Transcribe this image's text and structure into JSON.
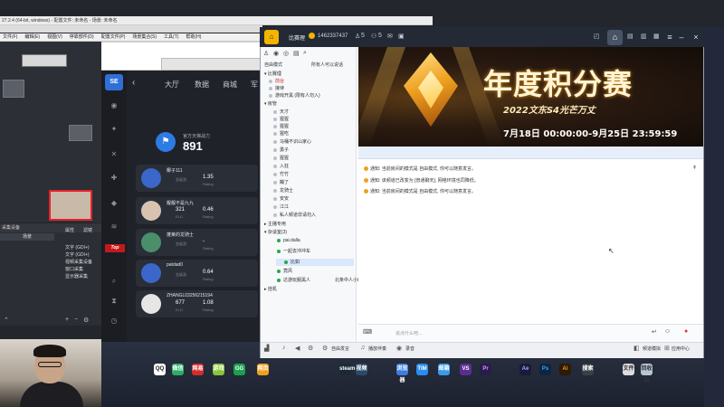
{
  "editor": {
    "title": "27.2.4 (64-bit, windows) - 配置文件: 未命名 - 场景: 未命名"
  },
  "obs": {
    "menu": [
      "文件(F)",
      "编辑(E)",
      "视图(V)",
      "停靠部件(D)",
      "配置文件(P)",
      "场景集合(S)",
      "工具(T)",
      "帮助(H)"
    ],
    "scene_header": "采集设备",
    "scene_sub": "场景",
    "sources": [
      "属性",
      "滤镜"
    ],
    "source_items": [
      "文字 (GDI+)",
      "文字 (GDI+)",
      "视频采集设备",
      "窗口采集",
      "显示器采集"
    ]
  },
  "game": {
    "logo": "SE",
    "tabs": [
      "大厅",
      "数据",
      "商城",
      "军"
    ],
    "top_badge": "Top",
    "fight_label": "官方天梯战力",
    "fight_value": "891",
    "ranks": [
      {
        "name": "椰子111",
        "n1": "1.35",
        "l1": "金级游",
        "n2": "",
        "l2": "Rating"
      },
      {
        "name": "靓靓不是九九",
        "n1": "321",
        "l1": "ELO",
        "n2": "0.46",
        "l2": "Rating"
      },
      {
        "name": "蓬莱的龙骑士",
        "n1": "-",
        "l1": "金级游",
        "n2": "-",
        "l2": "Rating"
      },
      {
        "name": "patdad0",
        "n1": "0.64",
        "l1": "金级游",
        "n2": "",
        "l2": "Rating"
      },
      {
        "name": "ZHANGL03256215194",
        "n1": "677",
        "l1": "ELO",
        "n2": "1.08",
        "l2": "Rating"
      }
    ]
  },
  "chat": {
    "app_name": "比赛理",
    "uid": "1462337437",
    "title_meta": [
      "5",
      "5"
    ],
    "left_header": "自由模式",
    "left_header_right": "所有人可以说话",
    "tree": [
      "比赛理",
      "前台",
      "接待",
      "游戏开黑 (限有人勿入)",
      "房管",
      "天才",
      "猩猩",
      "猩猩",
      "猩吃",
      "马桶不识山家心",
      "勇子",
      "猩猩",
      "入狂",
      "竹竹",
      "糊了",
      "龙骑士",
      "安安",
      "江江",
      "私人频道非请勿入",
      "主播专用",
      "杂谈室(3)",
      "pai.dalla",
      "一起去冲冲车",
      "比如",
      "竟风",
      "达游玩服黑人",
      "北条中人小田",
      "挂机"
    ],
    "banner": {
      "title": "年度积分赛",
      "subtitle": "2022文东S4光芒万丈",
      "date": "7月18日 00:00:00-9月25日 23:59:59"
    },
    "messages": [
      "通知: 当前房间的模式是 自由模式, 你可以随意发言。",
      "通知: 该频道已改变为 [普通聊天], 网络环境也同降低。",
      "通知: 当前房间的模式是 自由模式, 你可以随意发言。"
    ],
    "input_placeholder": "说点什么吧...",
    "bottom": [
      "自由发言",
      "播放伴奏",
      "录音",
      "频道模拟",
      "应用中心"
    ]
  },
  "taskbar": {
    "items": [
      "QQ",
      "微信",
      "网易",
      "游戏",
      "GG",
      "网页",
      "steam",
      "视频",
      "浏览器",
      "TIM",
      "邮箱",
      "VS",
      "Pr",
      "Ae",
      "Ps",
      "Ai",
      "搜索",
      "文件",
      "回收站"
    ]
  },
  "colors": {
    "accent": "#2d7be5",
    "banner_gold": "#f0a020",
    "brand_red": "#c21a1a"
  }
}
